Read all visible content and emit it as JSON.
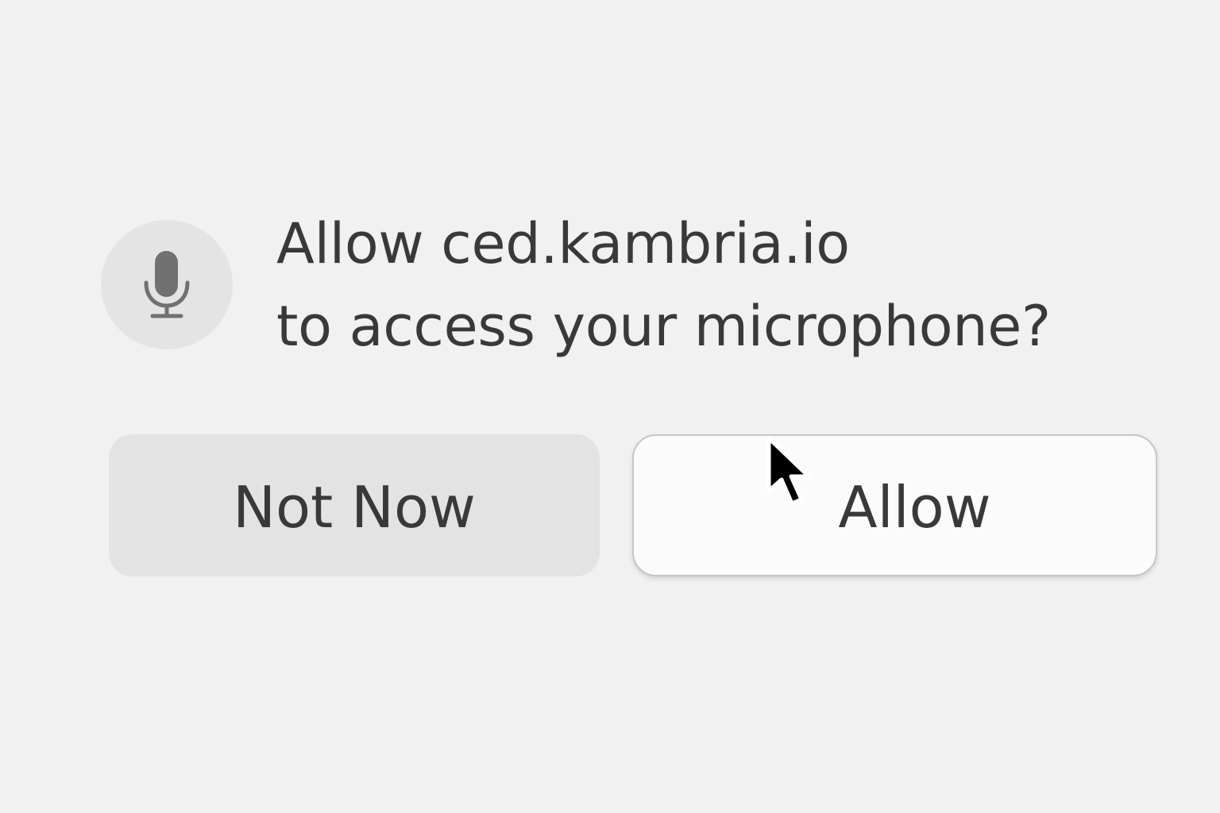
{
  "dialog": {
    "icon": "microphone-icon",
    "prompt_line1": "Allow ced.kambria.io",
    "prompt_line2": "to access your microphone?"
  },
  "buttons": {
    "not_now_label": "Not Now",
    "allow_label": "Allow"
  },
  "pointer": {
    "icon": "mouse-cursor-icon"
  },
  "colors": {
    "background": "#f1f1f1",
    "text": "#393939",
    "icon_circle": "#e4e4e4",
    "icon": "#717171",
    "not_now_button": "#e3e3e3",
    "allow_button": "#fbfbfb",
    "allow_border": "#c6c6c6"
  }
}
